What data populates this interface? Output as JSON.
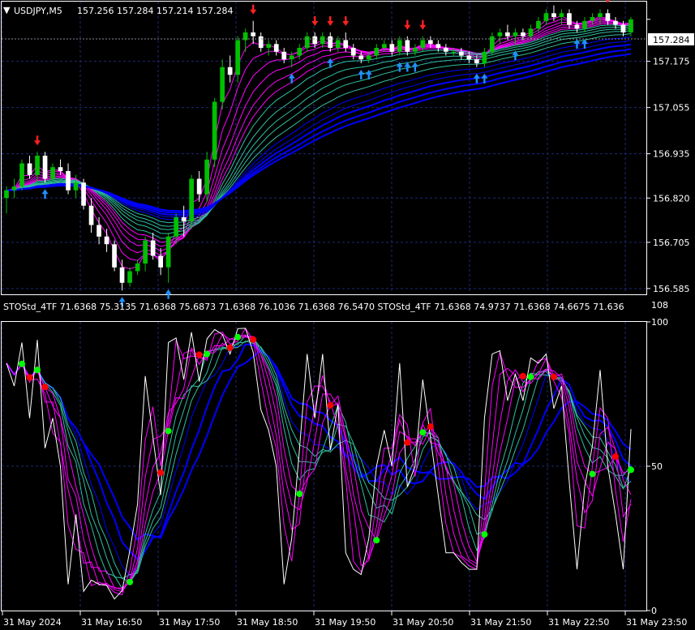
{
  "header": {
    "symbol_label": "USDJPY,M5",
    "ohlc": "157.256 157.284 157.214 157.284",
    "dropdown_glyph": "▼"
  },
  "subwindow": {
    "indicator_text": "STOStd_4TF 71.6368 75.3135 71.6368 75.6873 71.6368 76.1036 71.6368 76.5470  STOStd_4TF 71.6368 74.9737 71.6368 74.6675 71.636",
    "scale_top_label": "108"
  },
  "colors": {
    "background": "#000000",
    "grid": "#1e2a78",
    "bull_candle": "#00c000",
    "bear_candle": "#ffffff",
    "up_arrow": "#1e90ff",
    "down_arrow": "#ff2020",
    "stoch_main": "#ffffff",
    "ribbon_magenta": "#ff00ff",
    "ribbon_teal": "#2fbfa0",
    "ribbon_blue": "#0000ff",
    "dot_red": "#ff0000",
    "dot_green": "#00ff00"
  },
  "chart_data": [
    {
      "type": "candlestick",
      "name": "USDJPY,M5",
      "price_axis_ticks": [
        157.284,
        157.175,
        157.055,
        156.935,
        156.82,
        156.705,
        156.585
      ],
      "price_axis_tick_labels": [
        "157.284",
        "157.175",
        "157.055",
        "156.935",
        "156.820",
        "156.705",
        "156.585"
      ],
      "current_price": 157.284,
      "x_tick_labels": [
        "31 May 2024",
        "31 May 16:50",
        "31 May 17:50",
        "31 May 18:50",
        "31 May 19:50",
        "31 May 20:50",
        "31 May 21:50",
        "31 May 22:50",
        "31 May 23:50"
      ],
      "ylim": [
        156.57,
        157.33
      ],
      "candles": [
        [
          156.82,
          156.85,
          156.78,
          156.84
        ],
        [
          156.84,
          156.87,
          156.82,
          156.85
        ],
        [
          156.85,
          156.92,
          156.84,
          156.91
        ],
        [
          156.91,
          156.93,
          156.87,
          156.88
        ],
        [
          156.88,
          156.94,
          156.86,
          156.93
        ],
        [
          156.93,
          156.94,
          156.86,
          156.87
        ],
        [
          156.87,
          156.91,
          156.86,
          156.9
        ],
        [
          156.9,
          156.92,
          156.88,
          156.89
        ],
        [
          156.89,
          156.91,
          156.83,
          156.84
        ],
        [
          156.84,
          156.88,
          156.82,
          156.86
        ],
        [
          156.86,
          156.87,
          156.79,
          156.8
        ],
        [
          156.8,
          156.82,
          156.73,
          156.75
        ],
        [
          156.75,
          156.77,
          156.7,
          156.72
        ],
        [
          156.72,
          156.74,
          156.68,
          156.7
        ],
        [
          156.7,
          156.71,
          156.63,
          156.64
        ],
        [
          156.64,
          156.66,
          156.58,
          156.6
        ],
        [
          156.6,
          156.64,
          156.59,
          156.63
        ],
        [
          156.63,
          156.66,
          156.62,
          156.65
        ],
        [
          156.65,
          156.72,
          156.63,
          156.71
        ],
        [
          156.71,
          156.73,
          156.66,
          156.67
        ],
        [
          156.67,
          156.69,
          156.62,
          156.64
        ],
        [
          156.64,
          156.73,
          156.6,
          156.72
        ],
        [
          156.72,
          156.78,
          156.7,
          156.77
        ],
        [
          156.77,
          156.8,
          156.72,
          156.76
        ],
        [
          156.76,
          156.88,
          156.74,
          156.87
        ],
        [
          156.87,
          156.89,
          156.81,
          156.83
        ],
        [
          156.83,
          156.94,
          156.81,
          156.92
        ],
        [
          156.92,
          157.08,
          156.9,
          157.07
        ],
        [
          157.07,
          157.18,
          157.05,
          157.16
        ],
        [
          157.16,
          157.19,
          157.12,
          157.14
        ],
        [
          157.14,
          157.24,
          157.12,
          157.23
        ],
        [
          157.23,
          157.26,
          157.2,
          157.25
        ],
        [
          157.25,
          157.28,
          157.22,
          157.24
        ],
        [
          157.24,
          157.25,
          157.2,
          157.21
        ],
        [
          157.21,
          157.23,
          157.19,
          157.22
        ],
        [
          157.22,
          157.23,
          157.19,
          157.2
        ],
        [
          157.2,
          157.21,
          157.17,
          157.18
        ],
        [
          157.18,
          157.2,
          157.16,
          157.19
        ],
        [
          157.19,
          157.22,
          157.18,
          157.21
        ],
        [
          157.21,
          157.25,
          157.2,
          157.24
        ],
        [
          157.24,
          157.25,
          157.21,
          157.22
        ],
        [
          157.22,
          157.25,
          157.21,
          157.24
        ],
        [
          157.24,
          157.25,
          157.2,
          157.21
        ],
        [
          157.21,
          157.24,
          157.2,
          157.23
        ],
        [
          157.23,
          157.25,
          157.2,
          157.21
        ],
        [
          157.21,
          157.22,
          157.18,
          157.19
        ],
        [
          157.19,
          157.2,
          157.17,
          157.18
        ],
        [
          157.18,
          157.2,
          157.17,
          157.19
        ],
        [
          157.19,
          157.22,
          157.18,
          157.21
        ],
        [
          157.21,
          157.23,
          157.2,
          157.22
        ],
        [
          157.22,
          157.23,
          157.19,
          157.2
        ],
        [
          157.2,
          157.24,
          157.19,
          157.23
        ],
        [
          157.23,
          157.24,
          157.19,
          157.2
        ],
        [
          157.2,
          157.22,
          157.19,
          157.21
        ],
        [
          157.21,
          157.24,
          157.2,
          157.23
        ],
        [
          157.23,
          157.24,
          157.21,
          157.22
        ],
        [
          157.22,
          157.23,
          157.2,
          157.21
        ],
        [
          157.21,
          157.22,
          157.19,
          157.2
        ],
        [
          157.2,
          157.21,
          157.19,
          157.2
        ],
        [
          157.2,
          157.21,
          157.18,
          157.19
        ],
        [
          157.19,
          157.2,
          157.17,
          157.18
        ],
        [
          157.18,
          157.19,
          157.16,
          157.17
        ],
        [
          157.17,
          157.21,
          157.16,
          157.2
        ],
        [
          157.2,
          157.25,
          157.19,
          157.24
        ],
        [
          157.24,
          157.26,
          157.22,
          157.25
        ],
        [
          157.25,
          157.27,
          157.23,
          157.24
        ],
        [
          157.24,
          157.26,
          157.22,
          157.25
        ],
        [
          157.25,
          157.26,
          157.23,
          157.24
        ],
        [
          157.24,
          157.27,
          157.23,
          157.26
        ],
        [
          157.26,
          157.29,
          157.25,
          157.28
        ],
        [
          157.28,
          157.31,
          157.27,
          157.3
        ],
        [
          157.3,
          157.32,
          157.28,
          157.29
        ],
        [
          157.29,
          157.31,
          157.27,
          157.3
        ],
        [
          157.3,
          157.31,
          157.26,
          157.27
        ],
        [
          157.27,
          157.28,
          157.25,
          157.26
        ],
        [
          157.26,
          157.29,
          157.25,
          157.28
        ],
        [
          157.28,
          157.3,
          157.27,
          157.29
        ],
        [
          157.29,
          157.31,
          157.27,
          157.3
        ],
        [
          157.3,
          157.31,
          157.27,
          157.28
        ],
        [
          157.28,
          157.29,
          157.26,
          157.27
        ],
        [
          157.27,
          157.28,
          157.24,
          157.25
        ],
        [
          157.25,
          157.29,
          157.24,
          157.284
        ]
      ],
      "ribbon_periods": [
        3,
        5,
        7,
        9,
        11,
        13,
        15,
        18,
        21,
        24,
        28,
        32,
        36,
        40,
        45,
        50
      ]
    },
    {
      "type": "line",
      "name": "STOStd_4TF",
      "ylim": [
        0,
        100
      ],
      "axis_tick_labels": [
        "100",
        "50",
        "0"
      ],
      "axis_ticks": [
        100,
        50,
        0
      ]
    }
  ]
}
